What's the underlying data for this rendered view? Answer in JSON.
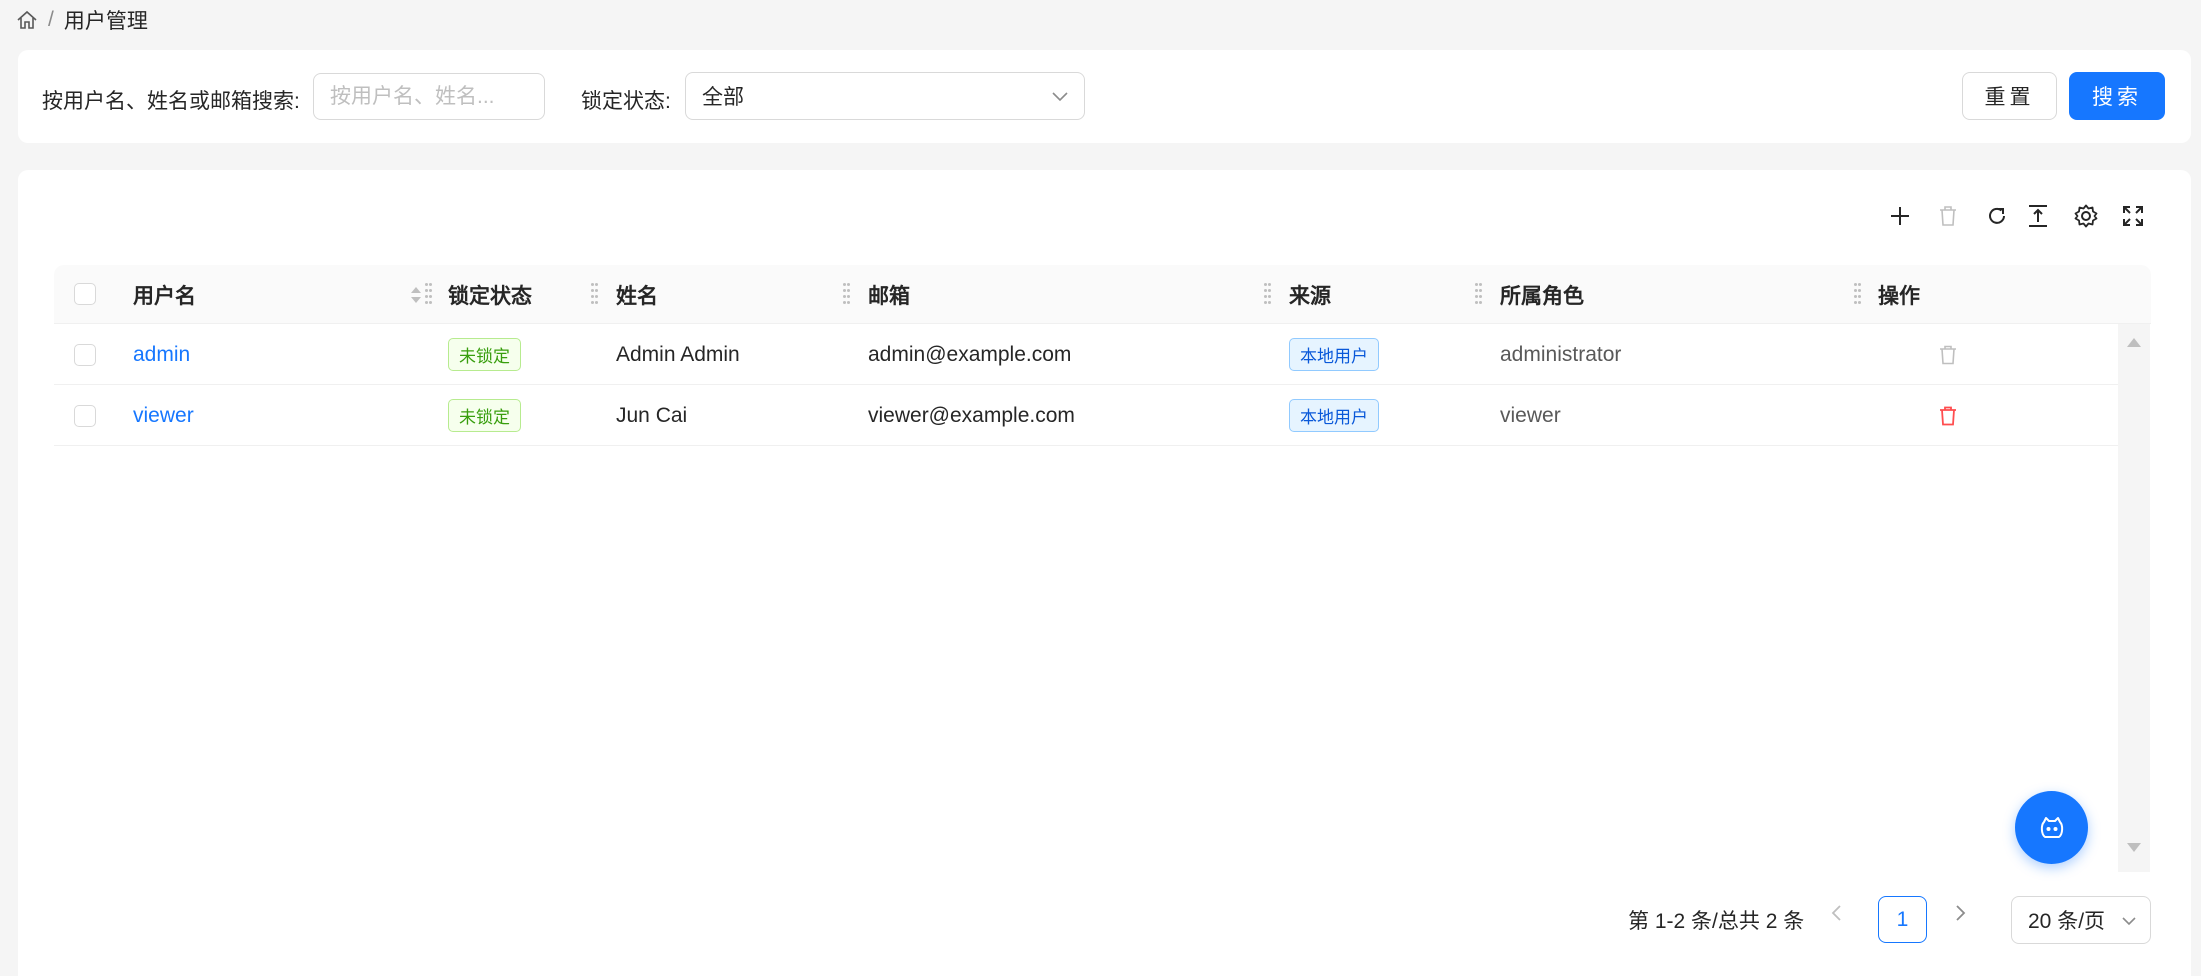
{
  "breadcrumb": {
    "separator": "/",
    "current": "用户管理"
  },
  "search": {
    "label": "按用户名、姓名或邮箱搜索:",
    "placeholder": "按用户名、姓名...",
    "value": "",
    "lock_label": "锁定状态:",
    "lock_value": "全部",
    "reset_label": "重置",
    "search_label": "搜索"
  },
  "toolbar": {
    "icons": [
      "plus-icon",
      "trash-icon",
      "reload-icon",
      "vertical-align-icon",
      "gear-icon",
      "fullscreen-icon"
    ]
  },
  "table": {
    "columns": [
      "用户名",
      "锁定状态",
      "姓名",
      "邮箱",
      "来源",
      "所属角色",
      "操作"
    ],
    "rows": [
      {
        "username": "admin",
        "lock": "未锁定",
        "name": "Admin Admin",
        "email": "admin@example.com",
        "source": "本地用户",
        "role": "administrator",
        "delete_enabled": false
      },
      {
        "username": "viewer",
        "lock": "未锁定",
        "name": "Jun Cai",
        "email": "viewer@example.com",
        "source": "本地用户",
        "role": "viewer",
        "delete_enabled": true
      }
    ]
  },
  "pagination": {
    "total_text": "第 1-2 条/总共 2 条",
    "current_page": "1",
    "page_size": "20 条/页"
  },
  "colors": {
    "primary": "#1677ff",
    "danger": "#ff4d4f",
    "success_tag": "#389e0d"
  }
}
